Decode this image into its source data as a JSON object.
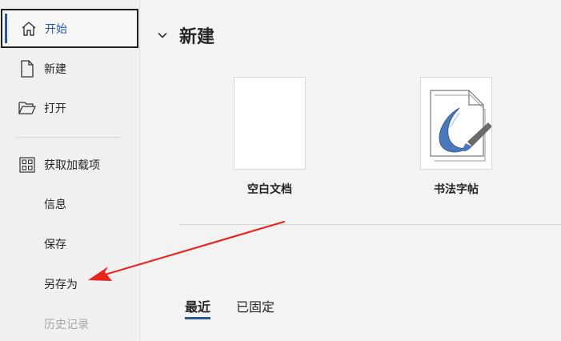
{
  "sidebar": {
    "items": [
      {
        "label": "开始",
        "icon": "home-icon"
      },
      {
        "label": "新建",
        "icon": "new-document-icon"
      },
      {
        "label": "打开",
        "icon": "open-folder-icon"
      },
      {
        "label": "获取加载项",
        "icon": "add-ins-grid-icon"
      },
      {
        "label": "信息"
      },
      {
        "label": "保存"
      },
      {
        "label": "另存为"
      },
      {
        "label": "历史记录"
      }
    ]
  },
  "main": {
    "section_title": "新建",
    "templates": [
      {
        "label": "空白文档"
      },
      {
        "label": "书法字帖"
      }
    ],
    "tabs": [
      {
        "label": "最近"
      },
      {
        "label": "已固定"
      }
    ]
  },
  "colors": {
    "accent": "#2b579a",
    "annotation_arrow": "#e8261e"
  }
}
